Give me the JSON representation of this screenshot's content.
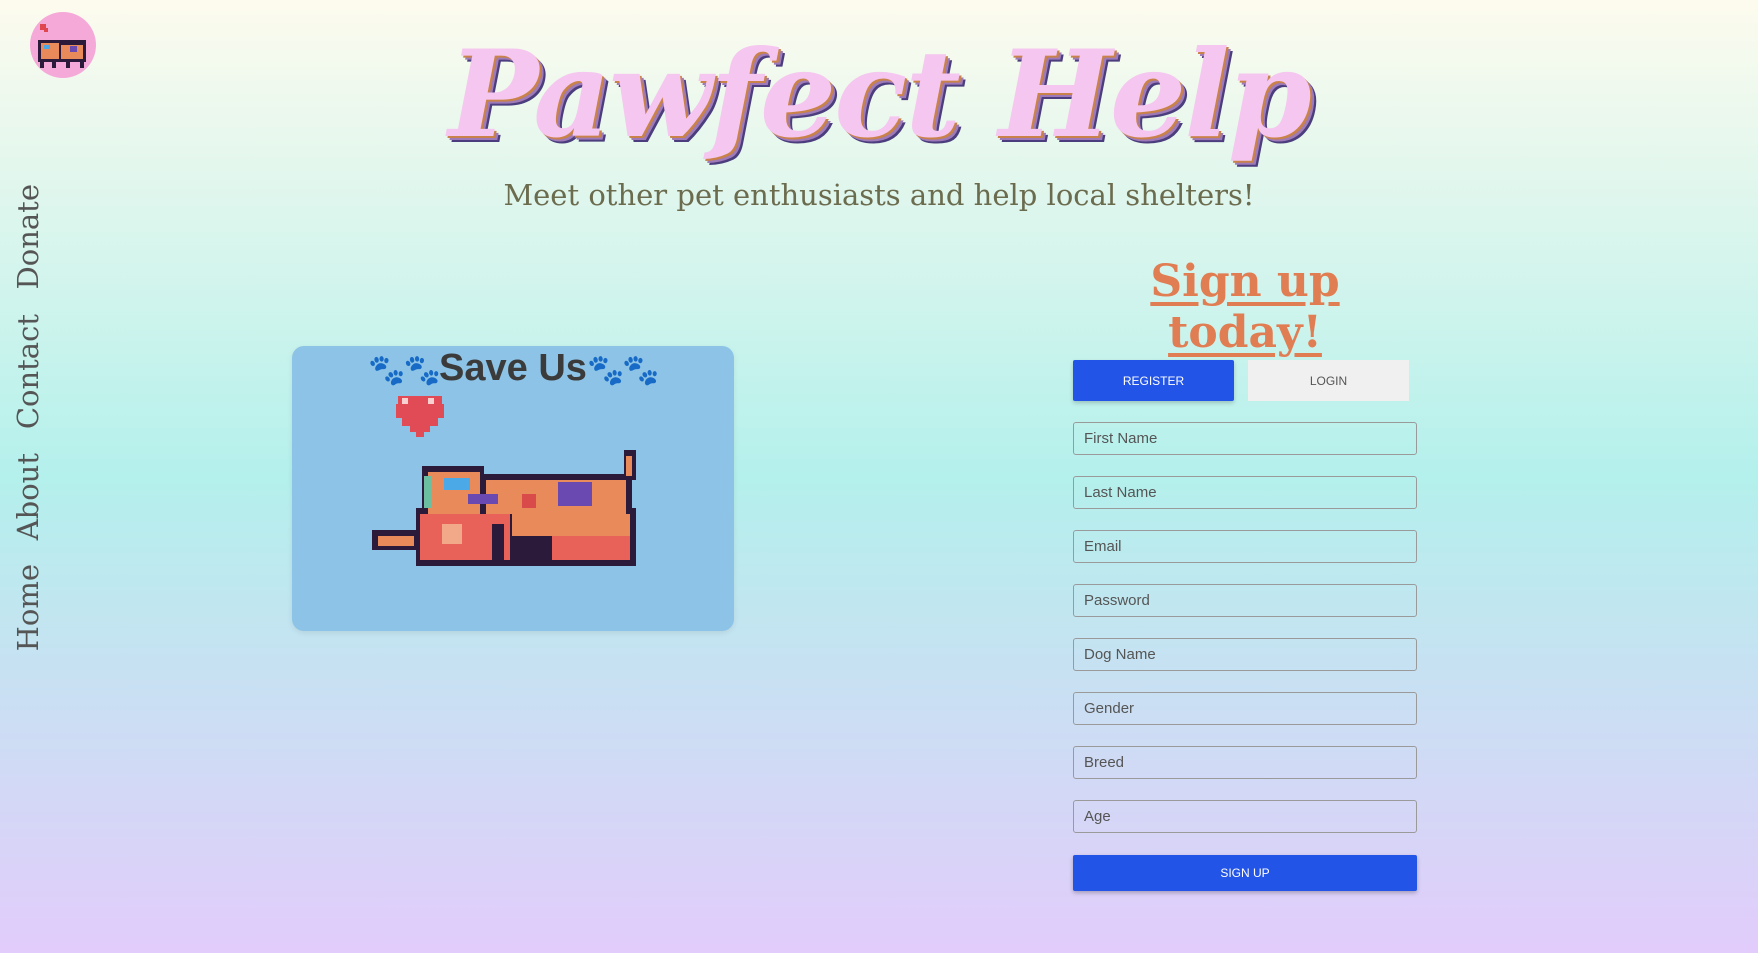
{
  "header": {
    "title": "Pawfect Help",
    "subtitle": "Meet other pet enthusiasts and help local shelters!"
  },
  "nav": {
    "items": [
      {
        "label": "Home"
      },
      {
        "label": "About"
      },
      {
        "label": "Contact"
      },
      {
        "label": "Donate"
      }
    ]
  },
  "card": {
    "paws_left": "🐾🐾",
    "title": "Save Us",
    "paws_right": "🐾🐾",
    "image_icon": "heart-and-puppies-pixel-icon"
  },
  "signup": {
    "heading": "Sign up today!",
    "tabs": {
      "register": "Register",
      "login": "Login"
    },
    "fields": [
      {
        "name": "first-name-field",
        "placeholder": "First Name"
      },
      {
        "name": "last-name-field",
        "placeholder": "Last Name"
      },
      {
        "name": "email-field",
        "placeholder": "Email"
      },
      {
        "name": "password-field",
        "placeholder": "Password"
      },
      {
        "name": "dog-name-field",
        "placeholder": "Dog Name"
      },
      {
        "name": "gender-field",
        "placeholder": "Gender"
      },
      {
        "name": "breed-field",
        "placeholder": "Breed"
      },
      {
        "name": "age-field",
        "placeholder": "Age"
      }
    ],
    "submit": "Sign Up"
  },
  "colors": {
    "accent": "#2354e8",
    "heading_orange": "#e07d52",
    "card_bg": "#8cc3e6",
    "title_pink": "#f5c6ef"
  }
}
